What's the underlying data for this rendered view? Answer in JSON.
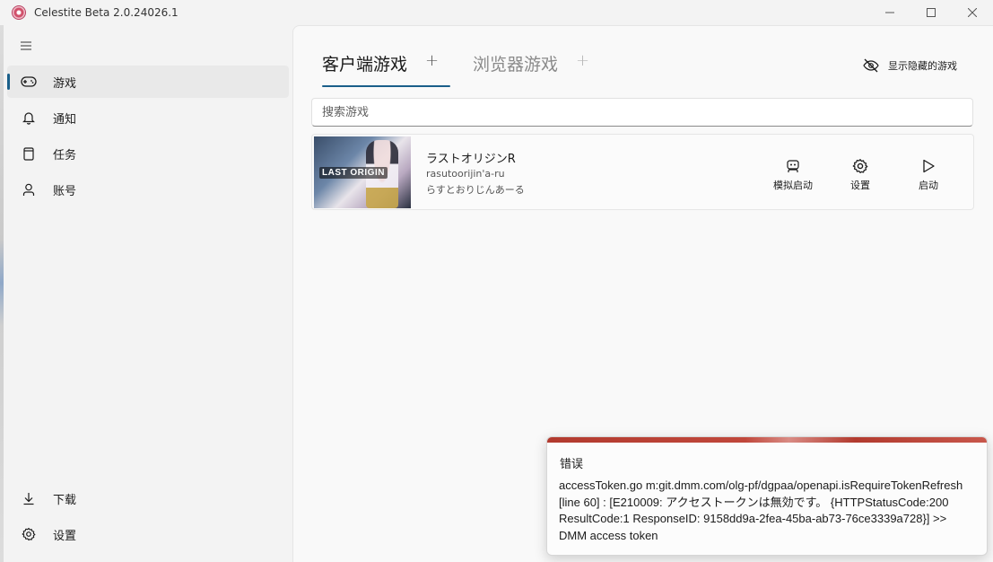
{
  "window": {
    "title": "Celestite Beta 2.0.24026.1",
    "controls": {
      "minimize": "—",
      "maximize": "☐",
      "close": "✕"
    }
  },
  "sidebar": {
    "menu_icon": "hamburger-icon",
    "items": [
      {
        "label": "游戏",
        "icon": "gamepad-icon",
        "active": true
      },
      {
        "label": "通知",
        "icon": "bell-icon",
        "active": false
      },
      {
        "label": "任务",
        "icon": "clipboard-icon",
        "active": false
      },
      {
        "label": "账号",
        "icon": "person-icon",
        "active": false
      }
    ],
    "footer_items": [
      {
        "label": "下载",
        "icon": "download-icon"
      },
      {
        "label": "设置",
        "icon": "gear-icon"
      }
    ]
  },
  "main": {
    "tabs": [
      {
        "label": "客户端游戏",
        "plus": "+",
        "active": true
      },
      {
        "label": "浏览器游戏",
        "plus": "+",
        "active": false
      }
    ],
    "show_hidden_label": "显示隐藏的游戏",
    "search": {
      "placeholder": "搜索游戏",
      "value": ""
    },
    "games": [
      {
        "thumbnail_text": "LAST ORIGIN",
        "name": "ラストオリジンR",
        "romaji": "rasutoorijin'a-ru",
        "kana": "らすとおりじんあーる",
        "actions": [
          {
            "label": "模拟启动",
            "icon": "robot-icon"
          },
          {
            "label": "设置",
            "icon": "gear-icon"
          },
          {
            "label": "启动",
            "icon": "play-icon"
          }
        ]
      }
    ]
  },
  "toast": {
    "title": "错误",
    "message": "accessToken.go m:git.dmm.com/olg-pf/dgpaa/openapi.isRequireTokenRefresh [line 60] : [E210009: アクセストークンは無効です。 {HTTPStatusCode:200 ResultCode:1 ResponseID: 9158dd9a-2fea-45ba-ab73-76ce3339a728}] >> DMM access token"
  },
  "colors": {
    "accent": "#1a5f8a",
    "error": "#b23a2e"
  }
}
